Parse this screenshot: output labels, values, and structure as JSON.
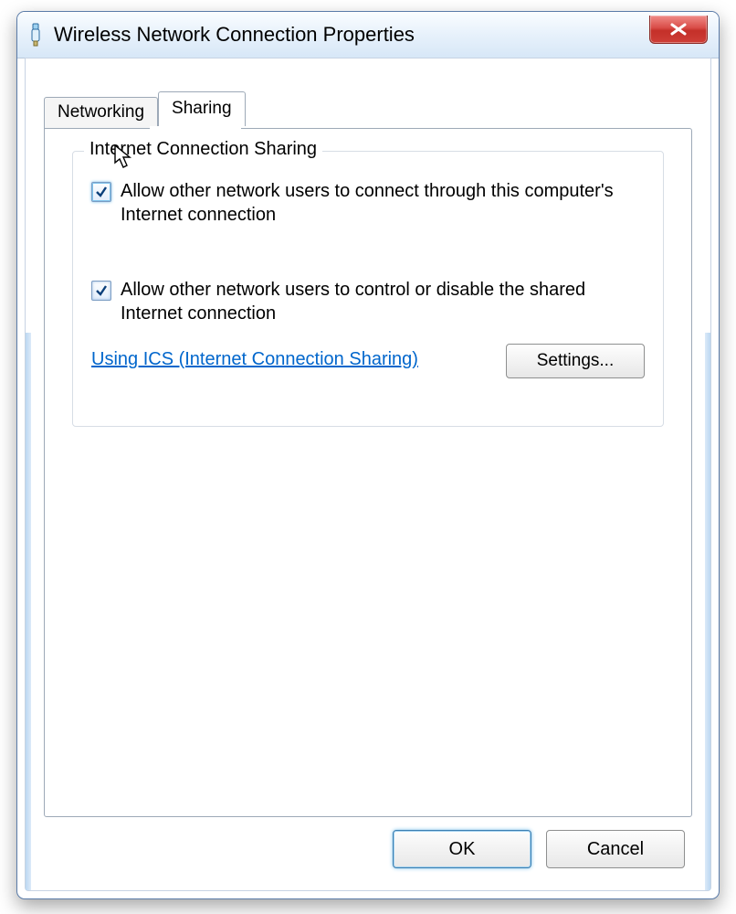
{
  "window": {
    "title": "Wireless Network Connection Properties"
  },
  "tabs": {
    "networking": "Networking",
    "sharing": "Sharing",
    "active_index": 1
  },
  "group": {
    "legend": "Internet Connection Sharing",
    "option_allow_connect": {
      "label": "Allow other network users to connect through this computer's Internet connection",
      "checked": true
    },
    "option_allow_control": {
      "label": "Allow other network users to control or disable the shared Internet connection",
      "checked": true
    },
    "help_link": "Using ICS (Internet Connection Sharing)",
    "settings_button": "Settings..."
  },
  "buttons": {
    "ok": "OK",
    "cancel": "Cancel"
  }
}
